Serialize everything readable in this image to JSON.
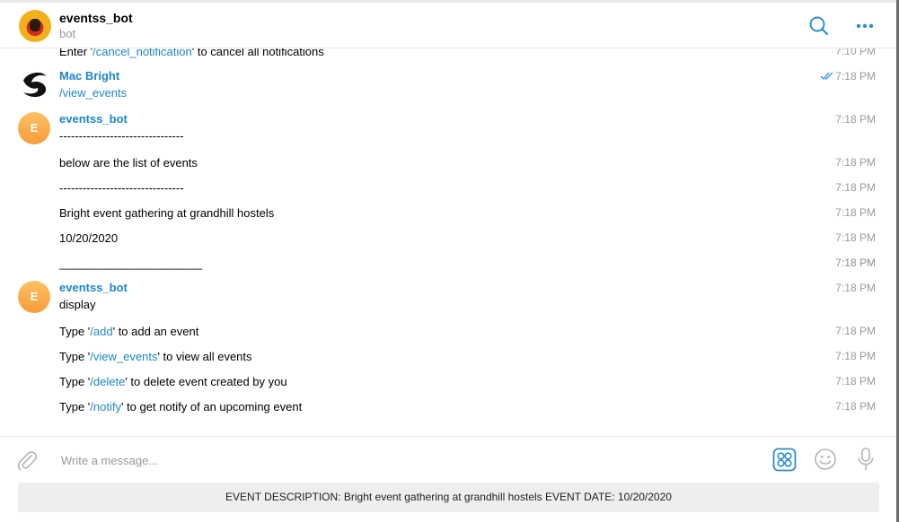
{
  "header": {
    "title": "eventss_bot",
    "subtitle": "bot"
  },
  "messages": {
    "cut_line": {
      "pre": "Enter '",
      "cmd": "/cancel_notification",
      "post": "' to cancel all notifications",
      "time": "7:10 PM"
    },
    "mac": {
      "name": "Mac Bright",
      "text": "/view_events",
      "time": "7:18 PM"
    },
    "group1": {
      "avatar_letter": "E",
      "name": "eventss_bot",
      "name_time": "7:18 PM",
      "lines": [
        {
          "text": "--------------------------------",
          "time": ""
        },
        {
          "text": "below are the list of events",
          "time": "7:18 PM"
        },
        {
          "text": "--------------------------------",
          "time": "7:18 PM"
        },
        {
          "text": "Bright event gathering at grandhill hostels",
          "time": "7:18 PM"
        },
        {
          "text": "10/20/2020",
          "time": "7:18 PM"
        },
        {
          "text": "",
          "time": "7:18 PM"
        },
        {
          "text": "______________________",
          "time": "7:18 PM"
        }
      ]
    },
    "group2": {
      "avatar_letter": "E",
      "name": "eventss_bot",
      "name_time": "7:18 PM",
      "first": "display",
      "cmd_lines": [
        {
          "pre": "Type '",
          "cmd": "/add",
          "post": "' to add an event",
          "time": "7:18 PM"
        },
        {
          "pre": "Type '",
          "cmd": "/view_events",
          "post": "' to view all events",
          "time": "7:18 PM"
        },
        {
          "pre": "Type '",
          "cmd": "/delete",
          "post": "' to delete event created by you",
          "time": "7:18 PM"
        },
        {
          "pre": "Type '",
          "cmd": "/notify",
          "post": "' to get notify of an upcoming event",
          "time": "7:18 PM"
        }
      ]
    }
  },
  "composer": {
    "placeholder": "Write a message..."
  },
  "keyboard_button": "EVENT DESCRIPTION:  Bright event gathering at grandhill hostels    EVENT DATE:  10/20/2020",
  "colors": {
    "accent": "#1f86c7",
    "time_gray": "#9a9a9a",
    "avatar_orange": "#f9a94b"
  },
  "icons": [
    "search-icon",
    "more-icon",
    "attach-icon",
    "bot-commands-icon",
    "emoji-icon",
    "microphone-icon",
    "read-checks-icon"
  ]
}
